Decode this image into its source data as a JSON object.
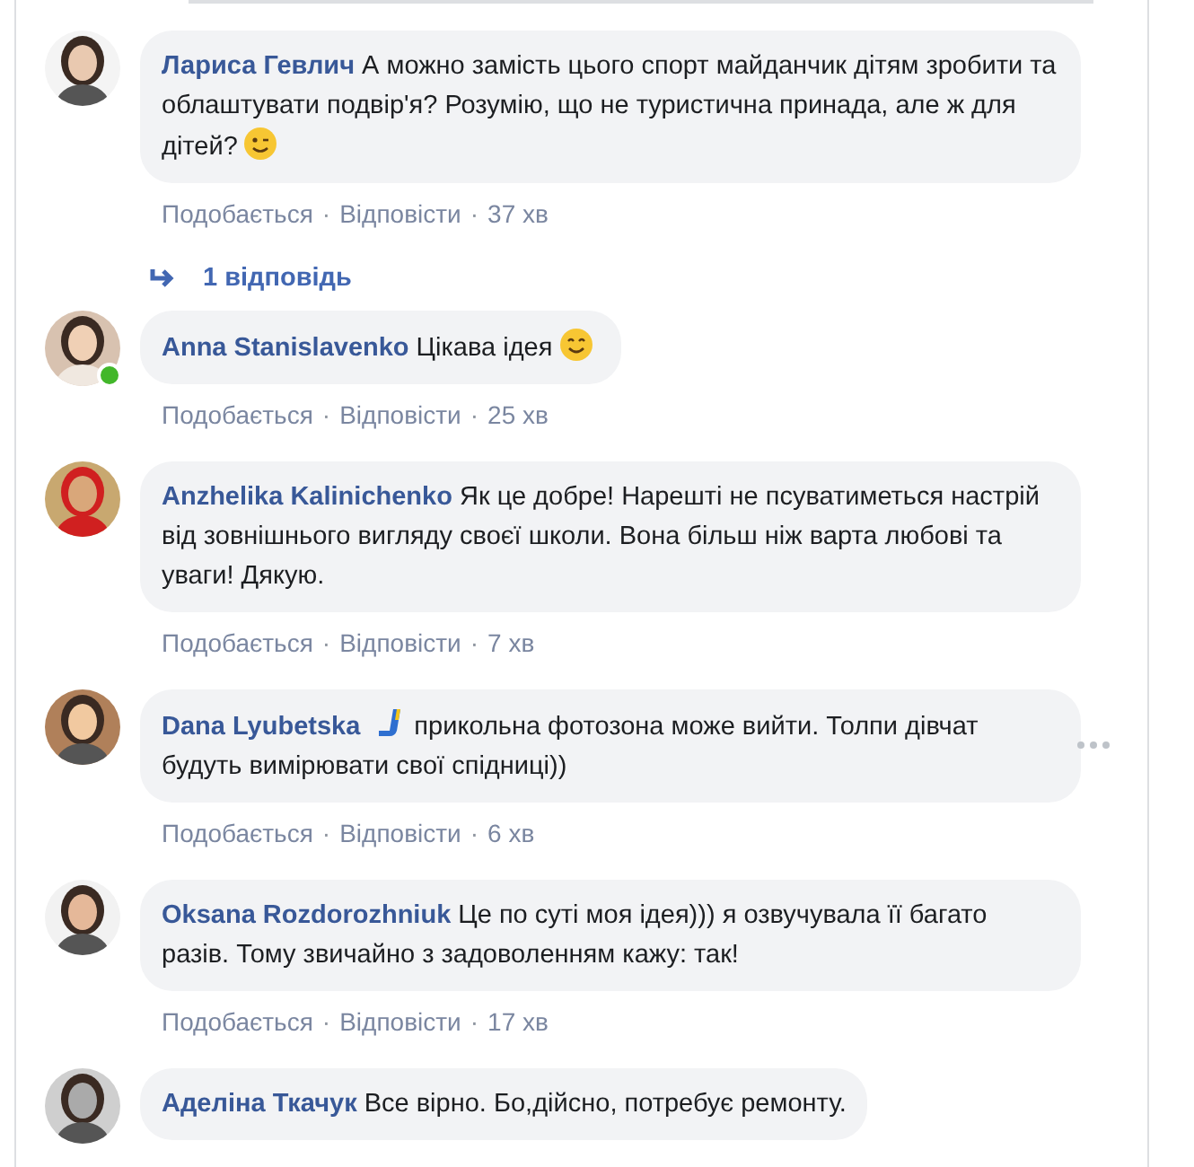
{
  "comments": [
    {
      "author": "Лариса Гевлич",
      "text": "А можно замість цього спорт майданчик дітям зробити та облаштувати подвір'я? Розумію, що не туристична принада, але ж для дітей?",
      "emoji_after": {
        "kind": "wink"
      },
      "online": false,
      "menu_visible": false,
      "actions": [
        "Подобається",
        "Відповісти"
      ],
      "separator": "·",
      "time": "37 хв",
      "replies": "1 відповідь"
    },
    {
      "author": "Anna Stanislavenko",
      "text": "Цікава ідея",
      "emoji_after": {
        "kind": "smile"
      },
      "online": true,
      "menu_visible": false,
      "actions": [
        "Подобається",
        "Відповісти"
      ],
      "separator": "·",
      "time": "25 хв"
    },
    {
      "author": "Anzhelika Kalinichenko",
      "text": "Як це добре! Нарешті не псуватиметься настрій від зовнішнього вигляду своєї школи. Вона більш ніж варта любові та уваги! Дякую.",
      "online": false,
      "menu_visible": false,
      "actions": [
        "Подобається",
        "Відповісти"
      ],
      "separator": "·",
      "time": "7 хв"
    },
    {
      "author": "Dana Lyubetska",
      "text": "прикольна фотозона може вийти. Толпи дівчат будуть вимірювати свої спідниці))",
      "emoji_before": {
        "kind": "stick"
      },
      "online": false,
      "menu_visible": true,
      "actions": [
        "Подобається",
        "Відповісти"
      ],
      "separator": "·",
      "time": "6 хв"
    },
    {
      "author": "Oksana Rozdorozhniuk",
      "text": "Це по суті моя ідея))) я озвучувала її багато разів. Тому звичайно з задоволенням кажу: так!",
      "online": false,
      "menu_visible": false,
      "actions": [
        "Подобається",
        "Відповісти"
      ],
      "separator": "·",
      "time": "17 хв"
    },
    {
      "author": "Аделіна Ткачук",
      "text": "Все вірно. Бо,дійсно, потребує ремонту.",
      "online": false,
      "menu_visible": false
    }
  ]
}
